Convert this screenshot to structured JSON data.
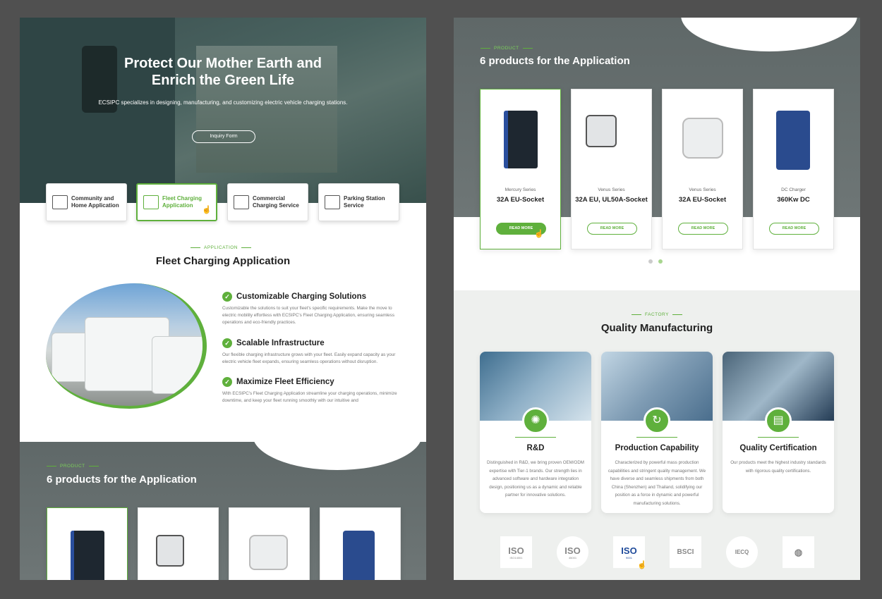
{
  "hero": {
    "title": "Protect Our Mother Earth and Enrich the Green Life",
    "subtitle": "ECSIPC specializes in designing, manufacturing, and customizing electric vehicle charging stations.",
    "button": "Inquiry Form"
  },
  "tabs": [
    {
      "label": "Community and Home Application",
      "icon": "home-app-icon"
    },
    {
      "label": "Fleet Charging Application",
      "icon": "car-charge-icon"
    },
    {
      "label": "Commercial Charging Service",
      "icon": "building-icon"
    },
    {
      "label": "Parking Station Service",
      "icon": "parking-icon"
    }
  ],
  "application": {
    "eyebrow": "APPLICATION",
    "title": "Fleet Charging Application",
    "features": [
      {
        "title": "Customizable Charging Solutions",
        "text": "Customizable the solutions to suit your fleet's specific requirements. Make the move to electric mobility effortless with ECSIPC's Fleet Charging Application, ensuring seamless operations and eco-friendly practices."
      },
      {
        "title": "Scalable Infrastructure",
        "text": "Our flexible charging infrastructure grows with your fleet. Easily expand capacity as your electric vehicle fleet expands, ensuring seamless operations without disruption."
      },
      {
        "title": "Maximize Fleet Efficiency",
        "text": "With ECSIPC's Fleet Charging Application streamline your charging operations, minimize downtime, and keep your fleet running smoothly with our intuitive and"
      }
    ]
  },
  "products": {
    "eyebrow": "PRODUCT",
    "title": "6 products for the Application",
    "read_more": "READ MORE",
    "items": [
      {
        "series": "Mercury Series",
        "name": "32A EU-Socket"
      },
      {
        "series": "Venus Series",
        "name": "32A EU, UL50A-Socket"
      },
      {
        "series": "Venus Series",
        "name": "32A EU-Socket"
      },
      {
        "series": "DC Charger",
        "name": "360Kw DC"
      }
    ]
  },
  "factory": {
    "eyebrow": "FACTORY",
    "title": "Quality Manufacturing",
    "cards": [
      {
        "title": "R&D",
        "text": "Distinguished in R&D, we bring proven OEM/ODM expertise with Tier-1 brands. Our strength lies in advanced software and hardware integration design, positioning us as a dynamic and reliable partner for innovative solutions.",
        "icon": "lightbulb-icon"
      },
      {
        "title": "Production Capability",
        "text": "Characterized by powerful mass production capabilities and stringent quality management. We have diverse and seamless shipments from both China (Shenzhen) and Thailand, solidifying our position as a force in dynamic and powerful manufacturing solutions.",
        "icon": "cycle-icon"
      },
      {
        "title": "Quality Certification",
        "text": "Our products meet the highest industry standards with rigorous quality certifications.",
        "icon": "certificate-icon"
      }
    ]
  },
  "certs": [
    {
      "label": "ISO",
      "sub": "ISO14001"
    },
    {
      "label": "ISO",
      "sub": "45001"
    },
    {
      "label": "ISO",
      "sub": "9001"
    },
    {
      "label": "BSCI",
      "sub": ""
    },
    {
      "label": "IECQ",
      "sub": ""
    },
    {
      "label": "",
      "sub": ""
    }
  ],
  "colors": {
    "accent": "#5fb03c"
  }
}
